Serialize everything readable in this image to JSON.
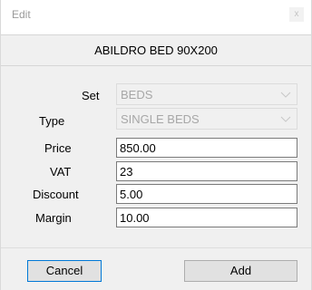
{
  "window": {
    "title": "Edit",
    "close_label": "x"
  },
  "product": {
    "name": "ABILDRO BED 90X200"
  },
  "form": {
    "set": {
      "label": "Set",
      "value": "BEDS"
    },
    "type": {
      "label": "Type",
      "value": "SINGLE BEDS"
    },
    "price": {
      "label": "Price",
      "value": "850.00"
    },
    "vat": {
      "label": "VAT",
      "value": "23"
    },
    "discount": {
      "label": "Discount",
      "value": "5.00"
    },
    "margin": {
      "label": "Margin",
      "value": "10.00"
    }
  },
  "buttons": {
    "cancel": "Cancel",
    "add": "Add"
  },
  "colors": {
    "accent": "#0078d7",
    "panel": "#f0f0f0",
    "disabled_text": "#a7a7a7"
  },
  "icons": {
    "dropdown": "chevron-down-icon"
  }
}
